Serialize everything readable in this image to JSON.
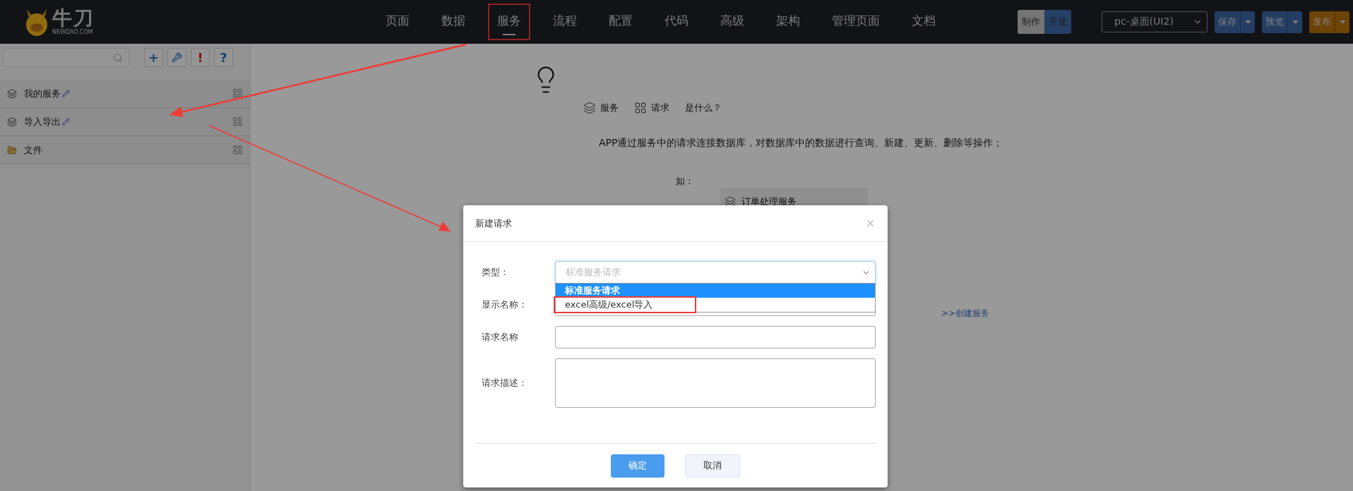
{
  "header": {
    "logo": {
      "name": "牛刀",
      "domain": "NEWDAO.COM"
    },
    "nav": [
      {
        "label": "页面",
        "selected": false,
        "highlighted": false
      },
      {
        "label": "数据",
        "selected": false,
        "highlighted": false
      },
      {
        "label": "服务",
        "selected": true,
        "highlighted": true
      },
      {
        "label": "流程",
        "selected": false,
        "highlighted": false
      },
      {
        "label": "配置",
        "selected": false,
        "highlighted": false
      },
      {
        "label": "代码",
        "selected": false,
        "highlighted": false
      },
      {
        "label": "高级",
        "selected": false,
        "highlighted": false
      },
      {
        "label": "架构",
        "selected": false,
        "highlighted": false
      },
      {
        "label": "管理页面",
        "selected": false,
        "highlighted": false
      },
      {
        "label": "文档",
        "selected": false,
        "highlighted": false
      }
    ],
    "mode_toggle": [
      {
        "label": "制作",
        "selected": false
      },
      {
        "label": "开发",
        "selected": true
      }
    ],
    "device_select": {
      "value": "pc-桌面(UI2)"
    },
    "actions": [
      {
        "label": "保存",
        "kind": "primary"
      },
      {
        "label": "预览",
        "kind": "primary"
      },
      {
        "label": "发布",
        "kind": "warning"
      }
    ]
  },
  "sidebar": {
    "tools": [
      {
        "kind": "glyph",
        "text": "+"
      },
      {
        "kind": "wrench"
      },
      {
        "kind": "alert",
        "text": "!"
      },
      {
        "kind": "glyph",
        "text": "?"
      }
    ],
    "items": [
      {
        "label": "我的服务",
        "kind": "service",
        "editable": true
      },
      {
        "label": "导入导出",
        "kind": "service",
        "editable": true
      },
      {
        "label": "文件",
        "kind": "folder",
        "editable": false
      }
    ]
  },
  "main": {
    "terms": [
      {
        "kind": "service",
        "label": "服务"
      },
      {
        "kind": "request",
        "label": "请求"
      }
    ],
    "question": "是什么？",
    "description": "APP通过服务中的请求连接数据库，对数据库中的数据进行查询、新建、更新、删除等操作；",
    "example_label": "如：",
    "example_card": "订单处理服务",
    "create_link": ">>创建服务"
  },
  "dialog": {
    "title": "新建请求",
    "fields": [
      {
        "label": "类型：",
        "kind": "select",
        "placeholder": "标准服务请求"
      },
      {
        "label": "显示名称：",
        "kind": "input"
      },
      {
        "label": "请求名称",
        "kind": "input"
      },
      {
        "label": "请求描述：",
        "kind": "textarea"
      }
    ],
    "dropdown": [
      {
        "label": "标准服务请求",
        "selected": true,
        "highlighted": false
      },
      {
        "label": "excel高级/excel导入",
        "selected": false,
        "highlighted": true
      }
    ],
    "buttons": [
      {
        "label": "确定",
        "kind": "primary"
      },
      {
        "label": "取消",
        "kind": "default"
      }
    ]
  }
}
